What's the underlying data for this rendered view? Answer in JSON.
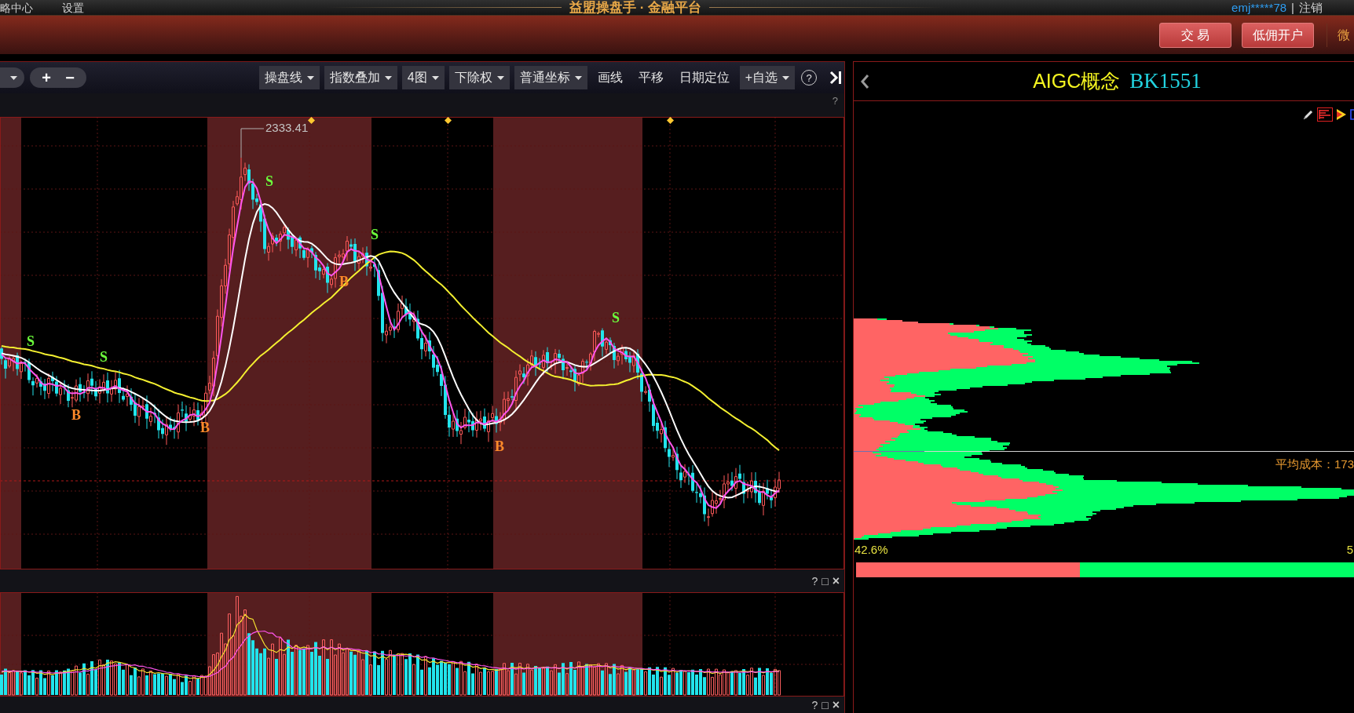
{
  "top_bar": {
    "menu_items": [
      "略中心",
      "设置"
    ],
    "title": "益盟操盘手 · 金融平台",
    "user": "emj*****78",
    "separator": "|",
    "logout": "注销"
  },
  "header_bar": {
    "buttons": [
      "交 易",
      "低佣开户"
    ],
    "link": "微"
  },
  "chart_toolbar": {
    "zoom_buttons": [
      "+",
      "−"
    ],
    "items": [
      {
        "label": "操盘线",
        "kind": "dropdown"
      },
      {
        "label": "指数叠加",
        "kind": "dropdown"
      },
      {
        "label": "4图",
        "kind": "dropdown"
      },
      {
        "label": "下除权",
        "kind": "dropdown"
      },
      {
        "label": "普通坐标",
        "kind": "dropdown"
      },
      {
        "label": "画线",
        "kind": "plain"
      },
      {
        "label": "平移",
        "kind": "plain"
      },
      {
        "label": "日期定位",
        "kind": "plain"
      },
      {
        "label": "+自选",
        "kind": "dropdown"
      }
    ],
    "help": "?"
  },
  "price_chart": {
    "help": "?",
    "peak_label": "2333.41",
    "signals": [
      {
        "kind": "sell",
        "label": "S"
      },
      {
        "kind": "buy",
        "label": "B"
      },
      {
        "kind": "sell",
        "label": "S"
      },
      {
        "kind": "buy",
        "label": "B"
      },
      {
        "kind": "sell",
        "label": "S"
      },
      {
        "kind": "buy",
        "label": "B"
      },
      {
        "kind": "sell",
        "label": "S"
      },
      {
        "kind": "buy",
        "label": "B"
      },
      {
        "kind": "sell",
        "label": "S"
      }
    ]
  },
  "volume_pane": {
    "controls": [
      "?",
      "□",
      "×"
    ]
  },
  "lower_pane": {
    "controls": [
      "?",
      "□",
      "×"
    ]
  },
  "sector_panel": {
    "name": "AIGC概念",
    "code": "BK1551"
  },
  "chip_panel": {
    "average_cost": "平均成本：173",
    "left_label": "42.6%",
    "right_label": "5",
    "ratio_bar": {
      "level": 0.45
    }
  }
}
